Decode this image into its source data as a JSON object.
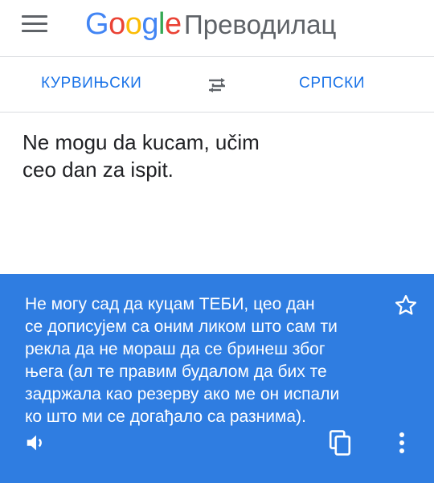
{
  "header": {
    "logo_letters": [
      {
        "char": "G",
        "color": "#4285F4"
      },
      {
        "char": "o",
        "color": "#EA4335"
      },
      {
        "char": "o",
        "color": "#FBBC05"
      },
      {
        "char": "g",
        "color": "#4285F4"
      },
      {
        "char": "l",
        "color": "#34A853"
      },
      {
        "char": "e",
        "color": "#EA4335"
      }
    ],
    "app_name": "Преводилац",
    "menu_icon": "hamburger-menu-icon"
  },
  "languages": {
    "source": "КУРВИЊСКИ",
    "target": "СРПСКИ",
    "swap_icon": "swap-arrows-icon",
    "accent_color": "#1a73e8"
  },
  "input": {
    "text_line1": "Ne mogu da kucam, učim",
    "text_line2": "ceo dan za ispit."
  },
  "result": {
    "background_color": "#2f7de1",
    "lines": [
      "Не могу сад да куцам ТЕБИ, цео дан",
      "се дописујем са оним ликом што сам ти",
      "рекла да не мораш да се бринеш због",
      "њега (ал те правим будалом да бих те",
      "задржала као резерву ако ме он испали",
      "ко што ми се догађало са разнима)."
    ],
    "icons": {
      "star": "star-outline-icon",
      "speaker": "speaker-icon",
      "copy": "copy-icon",
      "more": "more-vertical-icon"
    }
  }
}
